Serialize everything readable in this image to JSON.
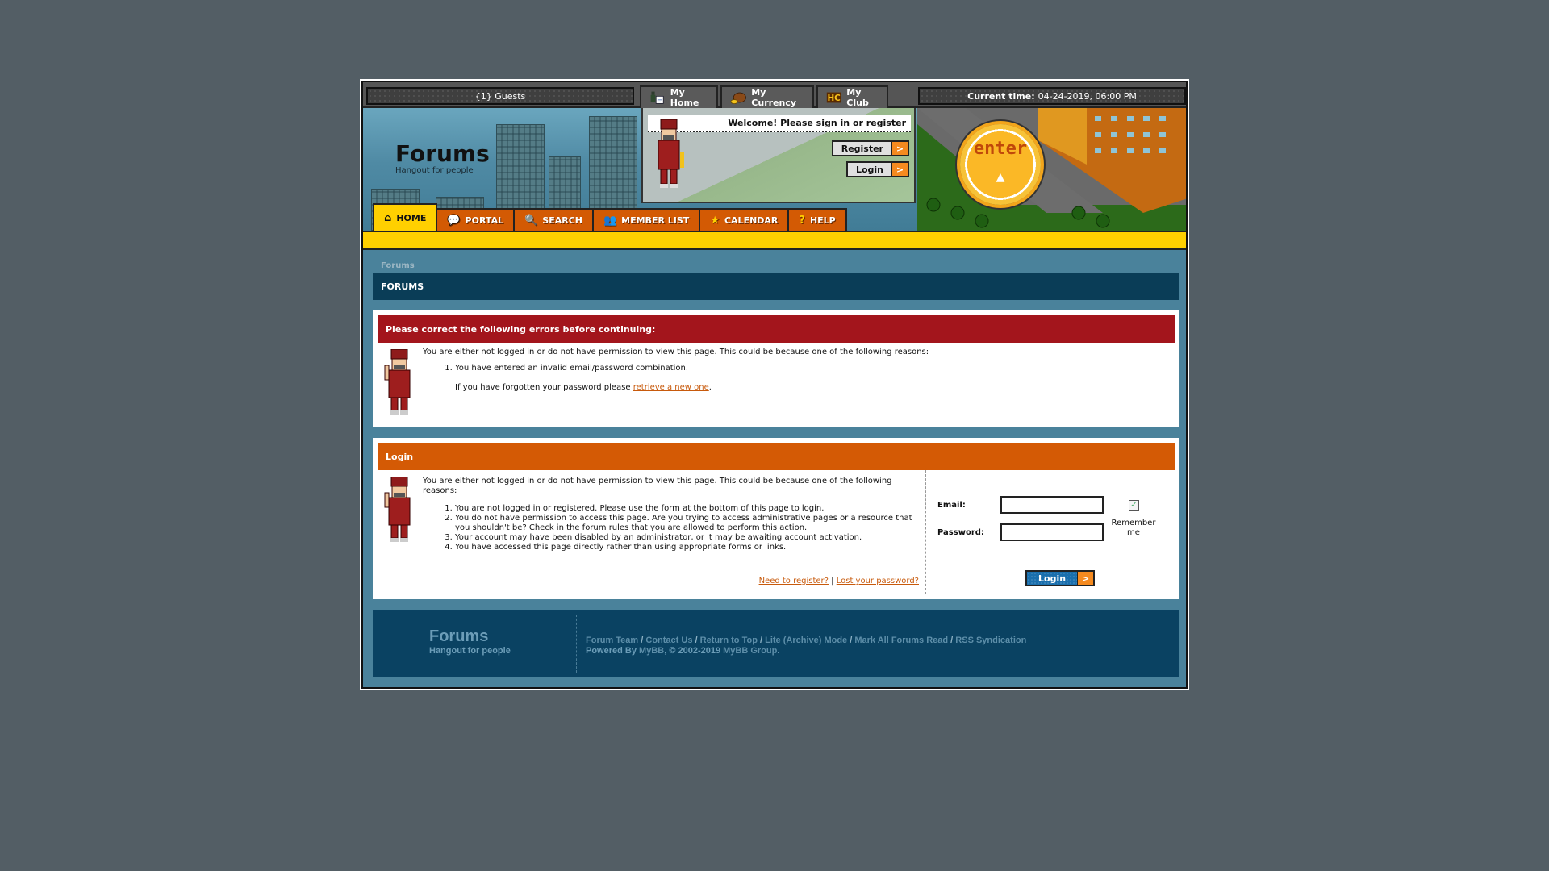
{
  "topbar": {
    "guests": "{1} Guests",
    "tabs": [
      {
        "label": "My Home",
        "icon": "home-avatar-icon"
      },
      {
        "label": "My Currency",
        "icon": "coin-bag-icon"
      },
      {
        "label": "My Club",
        "icon": "hc-club-icon"
      }
    ],
    "current_time_label": "Current time:",
    "current_time_value": "04-24-2019, 06:00 PM"
  },
  "header": {
    "title": "Forums",
    "subtitle": "Hangout for people",
    "welcome": "Welcome! Please sign in or register",
    "register_label": "Register",
    "login_label": "Login",
    "arrow": ">",
    "enter_badge": "enter",
    "enter_arrow": "▲"
  },
  "nav": {
    "tabs": [
      {
        "label": "HOME",
        "icon": "house-icon",
        "glyph": "⌂",
        "active": true
      },
      {
        "label": "PORTAL",
        "icon": "speech-bubble-icon",
        "glyph": "💬"
      },
      {
        "label": "SEARCH",
        "icon": "magnifier-icon",
        "glyph": "🔍"
      },
      {
        "label": "MEMBER LIST",
        "icon": "members-icon",
        "glyph": "👥"
      },
      {
        "label": "CALENDAR",
        "icon": "star-icon",
        "glyph": "★"
      },
      {
        "label": "HELP",
        "icon": "question-icon",
        "glyph": "?"
      }
    ]
  },
  "breadcrumb": "Forums",
  "section_title": "FORUMS",
  "error_panel": {
    "title": "Please correct the following errors before continuing:",
    "intro": "You are either not logged in or do not have permission to view this page. This could be because one of the following reasons:",
    "reasons": [
      "You have entered an invalid email/password combination."
    ],
    "forgot_prefix": "If you have forgotten your password please ",
    "forgot_link": "retrieve a new one",
    "forgot_suffix": "."
  },
  "login_panel": {
    "title": "Login",
    "intro": "You are either not logged in or do not have permission to view this page. This could be because one of the following reasons:",
    "reasons": [
      "You are not logged in or registered. Please use the form at the bottom of this page to login.",
      "You do not have permission to access this page. Are you trying to access administrative pages or a resource that you shouldn't be? Check in the forum rules that you are allowed to perform this action.",
      "Your account may have been disabled by an administrator, or it may be awaiting account activation.",
      "You have accessed this page directly rather than using appropriate forms or links."
    ],
    "need_register": "Need to register?",
    "separator": "|",
    "lost_password": "Lost your password?",
    "email_label": "Email:",
    "email_value": "",
    "password_label": "Password:",
    "password_value": "",
    "remember_label": "Remember me",
    "remember_checked": true,
    "check_glyph": "✓",
    "submit_label": "Login",
    "submit_arrow": ">"
  },
  "footer": {
    "title": "Forums",
    "subtitle": "Hangout for people",
    "links": [
      "Forum Team",
      "Contact Us",
      "Return to Top",
      "Lite (Archive) Mode",
      "Mark All Forums Read",
      "RSS Syndication"
    ],
    "link_sep": "/",
    "powered_prefix": "Powered By ",
    "powered_link": "MyBB",
    "copyright": ", © 2002-2019 ",
    "group_link": "MyBB Group",
    "end": "."
  },
  "colors": {
    "page_bg": "#535e65",
    "content_bg": "#4a829b",
    "header_dark": "#0a3d57",
    "error_red": "#a3151c",
    "login_orange": "#d45a05",
    "nav_orange": "#d35a04",
    "nav_active_yellow": "#ffd000",
    "button_arrow_orange": "#f58a1f",
    "login_button_blue": "#1a6fad",
    "link_orange": "#c85a0c",
    "footer_bg": "#0a4262"
  }
}
